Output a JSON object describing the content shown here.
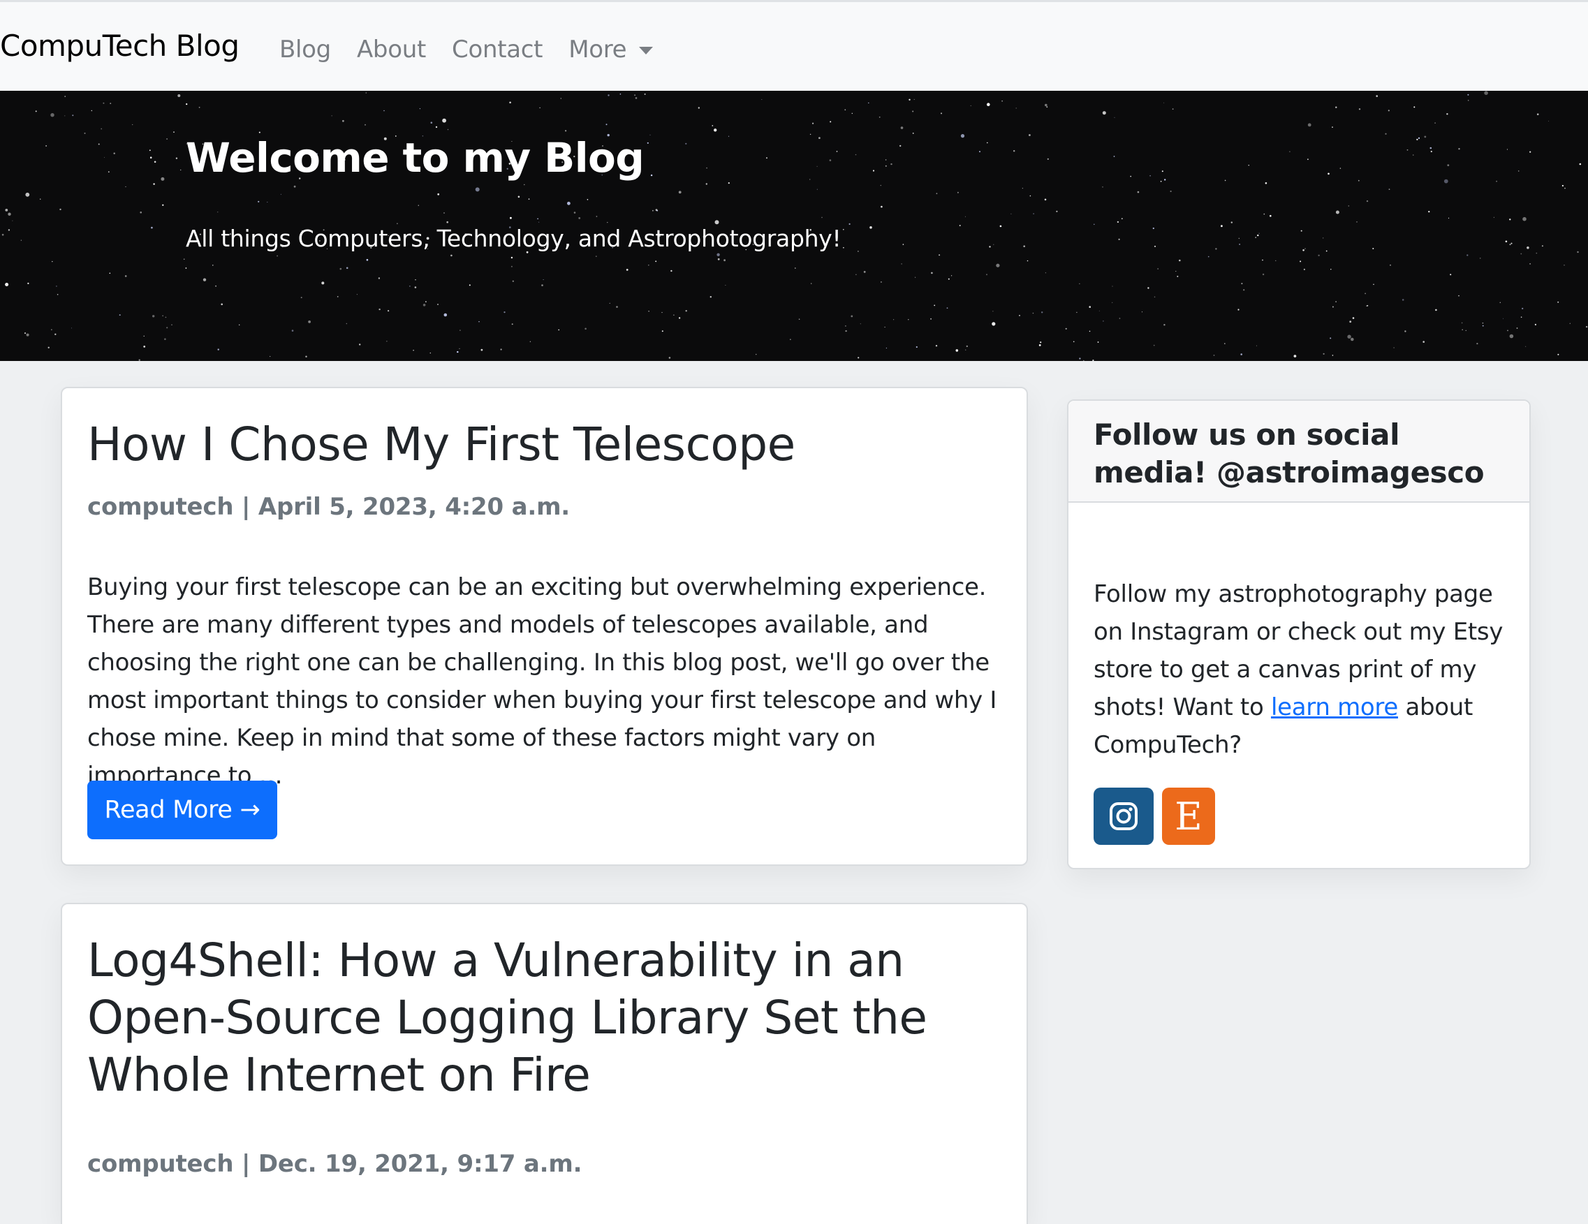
{
  "navbar": {
    "brand": "CompuTech Blog",
    "links": [
      "Blog",
      "About",
      "Contact",
      "More"
    ]
  },
  "hero": {
    "title": "Welcome to my Blog",
    "subtitle": "All things Computers, Technology, and Astrophotography!"
  },
  "posts": [
    {
      "title": "How I Chose My First Telescope",
      "meta": "computech | April 5, 2023, 4:20 a.m.",
      "excerpt": "Buying your first telescope can be an exciting but overwhelming experience. There are many different types and models of telescopes available, and choosing the right one can be challenging. In this blog post, we'll go over the most important things to consider when buying your first telescope and why I chose mine. Keep in mind that some of these factors might vary on importance to …",
      "button": "Read More →"
    },
    {
      "title": "Log4Shell: How a Vulnerability in an Open-Source Logging Library Set the Whole Internet on Fire",
      "meta": "computech | Dec. 19, 2021, 9:17 a.m."
    }
  ],
  "sidebar": {
    "title": "Follow us on social media! @astroimagesco",
    "body_before": "Follow my astrophotography page on Instagram or check out my Etsy store to get a canvas print of my shots! Want to ",
    "link": "learn more",
    "body_after": " about CompuTech?",
    "etsy_letter": "E",
    "colors": {
      "instagram": "#1a5a8c",
      "etsy": "#ec6a1b",
      "link": "#0d6efd"
    }
  }
}
